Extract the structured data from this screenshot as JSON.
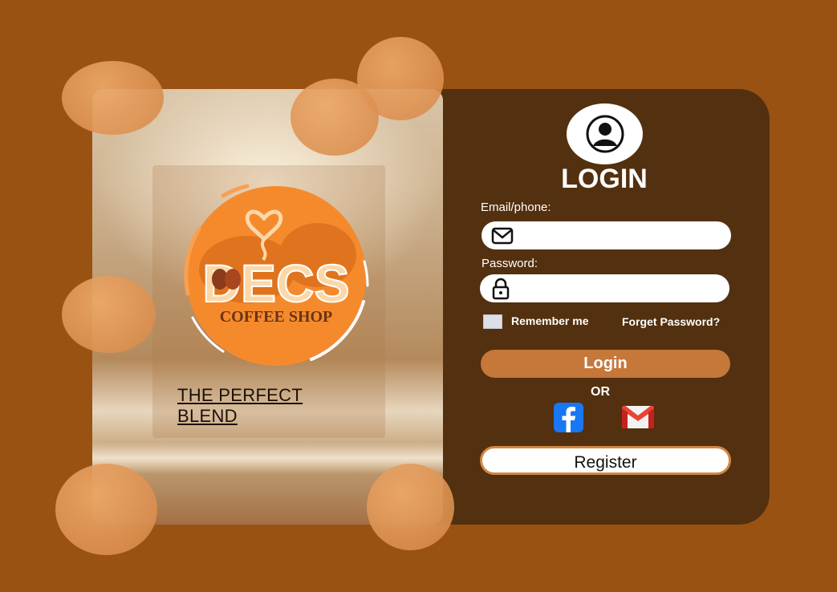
{
  "brand": {
    "logo_text": "DECS",
    "logo_subtext": "COFFEE SHOP",
    "tagline": "THE PERFECT BLEND"
  },
  "login": {
    "title": "LOGIN",
    "email_label": "Email/phone:",
    "email_value": "",
    "password_label": "Password:",
    "password_value": "",
    "remember_label": "Remember me",
    "remember_checked": false,
    "forget_label": "Forget Password?",
    "login_button": "Login",
    "or_text": "OR",
    "register_button": "Register"
  },
  "icons": {
    "avatar": "user-circle-icon",
    "email": "envelope-icon",
    "password": "padlock-icon",
    "facebook": "facebook-icon",
    "gmail": "gmail-icon"
  },
  "colors": {
    "page_background": "#9a5213",
    "card_background": "#53300f",
    "accent": "#c6773a",
    "register_border": "#cf8744",
    "facebook": "#1877f2",
    "gmail_red": "#ea4335"
  }
}
